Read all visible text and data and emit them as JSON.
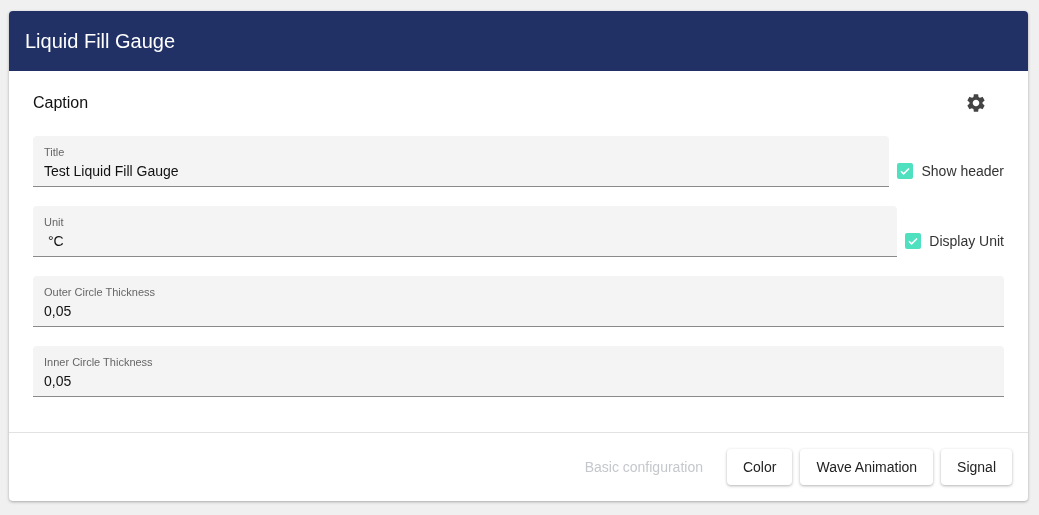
{
  "window": {
    "title": "Liquid Fill Gauge"
  },
  "section": {
    "title": "Caption"
  },
  "fields": [
    {
      "label": "Title",
      "value": "Test Liquid Fill Gauge",
      "checkbox": {
        "label": "Show header",
        "checked": true
      }
    },
    {
      "label": "Unit",
      "value": " °C",
      "checkbox": {
        "label": "Display Unit",
        "checked": true
      }
    },
    {
      "label": "Outer Circle Thickness",
      "value": "0,05"
    },
    {
      "label": "Inner Circle Thickness",
      "value": "0,05"
    }
  ],
  "buttons": [
    {
      "label": "Basic configuration",
      "kind": "flat",
      "disabled": true
    },
    {
      "label": "Color",
      "kind": "raised",
      "disabled": false
    },
    {
      "label": "Wave Animation",
      "kind": "raised",
      "disabled": false
    },
    {
      "label": "Signal",
      "kind": "raised",
      "disabled": false
    }
  ]
}
